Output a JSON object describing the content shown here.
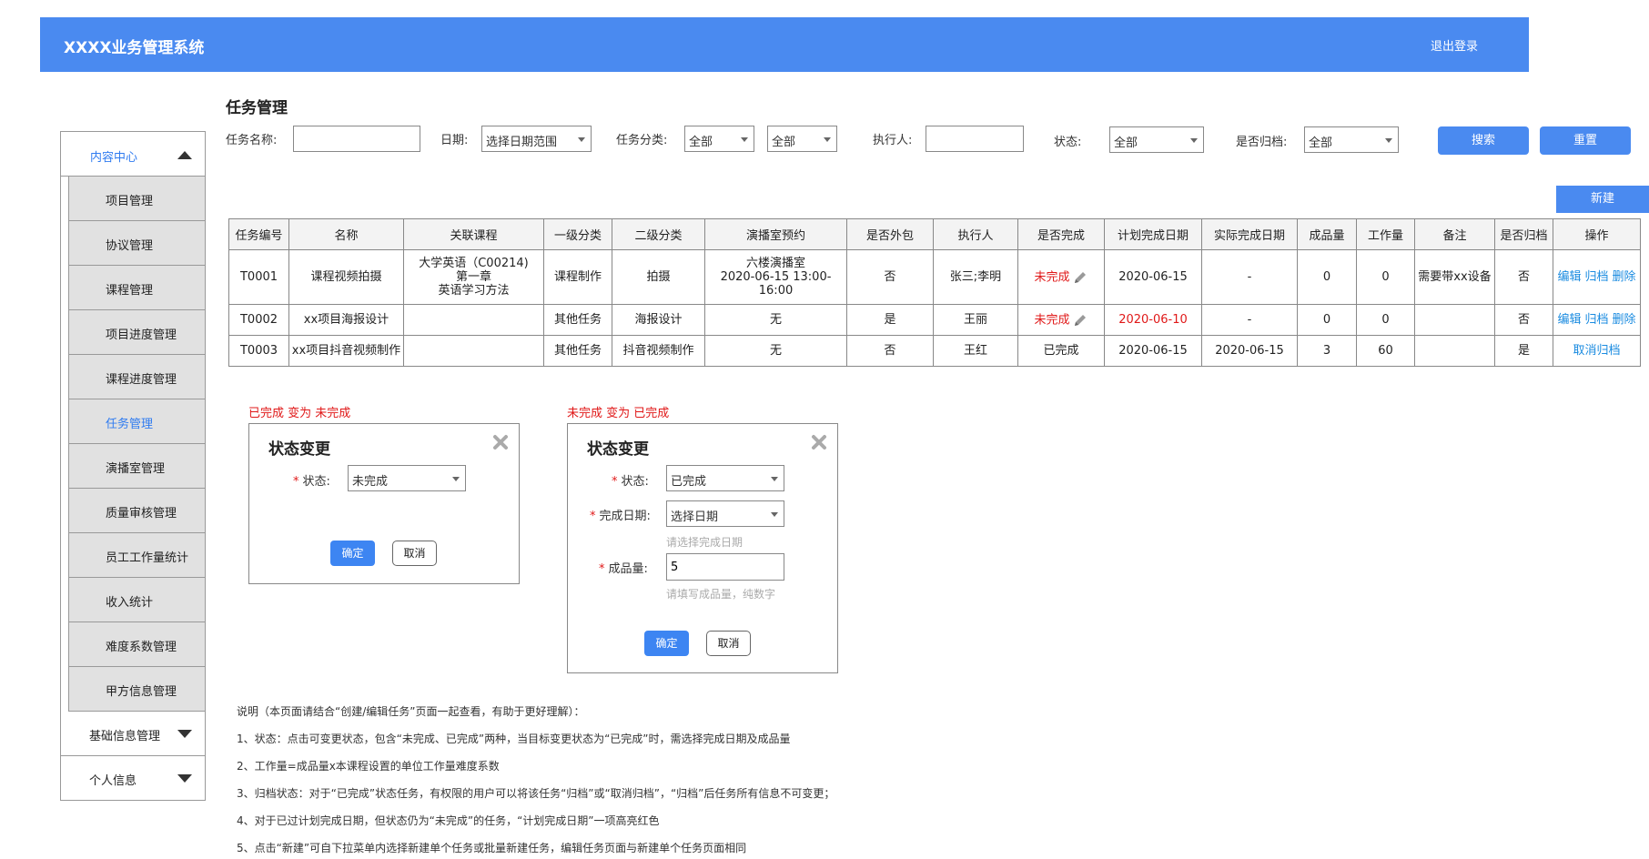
{
  "app": {
    "title": "XXXX业务管理系统",
    "logout": "退出登录"
  },
  "page_title": "任务管理",
  "sidebar": {
    "content_center": "内容中心",
    "items": [
      {
        "label": "项目管理",
        "active": false
      },
      {
        "label": "协议管理",
        "active": false
      },
      {
        "label": "课程管理",
        "active": false
      },
      {
        "label": "项目进度管理",
        "active": false
      },
      {
        "label": "课程进度管理",
        "active": false
      },
      {
        "label": "任务管理",
        "active": true
      },
      {
        "label": "演播室管理",
        "active": false
      },
      {
        "label": "质量审核管理",
        "active": false
      },
      {
        "label": "员工工作量统计",
        "active": false
      },
      {
        "label": "收入统计",
        "active": false
      },
      {
        "label": "难度系数管理",
        "active": false
      },
      {
        "label": "甲方信息管理",
        "active": false
      }
    ],
    "groups": [
      "基础信息管理",
      "个人信息"
    ]
  },
  "filters": {
    "task_name_label": "任务名称:",
    "task_name_value": "",
    "date_label": "日期:",
    "date_value": "选择日期范围",
    "category_label": "任务分类:",
    "category1_value": "全部",
    "category2_value": "全部",
    "executor_label": "执行人:",
    "executor_value": "",
    "status_label": "状态:",
    "status_value": "全部",
    "archived_label": "是否归档:",
    "archived_value": "全部",
    "search_button": "搜索",
    "reset_button": "重置",
    "new_button": "新建"
  },
  "table": {
    "columns": [
      "任务编号",
      "名称",
      "关联课程",
      "一级分类",
      "二级分类",
      "演播室预约",
      "是否外包",
      "执行人",
      "是否完成",
      "计划完成日期",
      "实际完成日期",
      "成品量",
      "工作量",
      "备注",
      "是否归档",
      "操作"
    ],
    "rows": [
      {
        "id": "T0001",
        "name": "课程视频拍摄",
        "course": [
          "大学英语（C00214)",
          "第一章",
          "英语学习方法"
        ],
        "cat1": "课程制作",
        "cat2": "拍摄",
        "studio": [
          "六楼演播室",
          "2020-06-15 13:00-16:00"
        ],
        "outsourced": "否",
        "executor": "张三;李明",
        "done": "未完成",
        "done_red": true,
        "editable": true,
        "plan_date": "2020-06-15",
        "plan_red": false,
        "actual_date": "-",
        "output": "0",
        "workload": "0",
        "remark": "需要带xx设备",
        "archived": "否",
        "ops": [
          "编辑",
          "归档",
          "删除"
        ]
      },
      {
        "id": "T0002",
        "name": "xx项目海报设计",
        "course": [],
        "cat1": "其他任务",
        "cat2": "海报设计",
        "studio": [
          "无"
        ],
        "outsourced": "是",
        "executor": "王丽",
        "done": "未完成",
        "done_red": true,
        "editable": true,
        "plan_date": "2020-06-10",
        "plan_red": true,
        "actual_date": "-",
        "output": "0",
        "workload": "0",
        "remark": "",
        "archived": "否",
        "ops": [
          "编辑",
          "归档",
          "删除"
        ]
      },
      {
        "id": "T0003",
        "name": "xx项目抖音视频制作",
        "course": [],
        "cat1": "其他任务",
        "cat2": "抖音视频制作",
        "studio": [
          "无"
        ],
        "outsourced": "否",
        "executor": "王红",
        "done": "已完成",
        "done_red": false,
        "editable": false,
        "plan_date": "2020-06-15",
        "plan_red": false,
        "actual_date": "2020-06-15",
        "output": "3",
        "workload": "60",
        "remark": "",
        "archived": "是",
        "ops": [
          "取消归档"
        ]
      }
    ]
  },
  "dialog1": {
    "caption": "已完成  变为  未完成",
    "title": "状态变更",
    "status_label": "状态:",
    "status_value": "未完成",
    "ok": "确定",
    "cancel": "取消"
  },
  "dialog2": {
    "caption": "未完成  变为  已完成",
    "title": "状态变更",
    "status_label": "状态:",
    "status_value": "已完成",
    "date_label": "完成日期:",
    "date_value": "选择日期",
    "date_hint": "请选择完成日期",
    "output_label": "成品量:",
    "output_value": "5",
    "output_hint": "请填写成品量，纯数字",
    "ok": "确定",
    "cancel": "取消"
  },
  "notes": [
    "说明（本页面请结合“创建/编辑任务”页面一起查看，有助于更好理解）：",
    "1、状态：点击可变更状态，包含“未完成、已完成”两种，当目标变更状态为“已完成”时，需选择完成日期及成品量",
    "2、工作量=成品量x本课程设置的单位工作量难度系数",
    "3、归档状态：对于“已完成”状态任务，有权限的用户可以将该任务“归档”或“取消归档”，“归档”后任务所有信息不可变更；",
    "4、对于已过计划完成日期，但状态仍为“未完成”的任务，“计划完成日期”一项高亮红色",
    "5、点击“新建”可自下拉菜单内选择新建单个任务或批量新建任务，编辑任务页面与新建单个任务页面相同"
  ]
}
